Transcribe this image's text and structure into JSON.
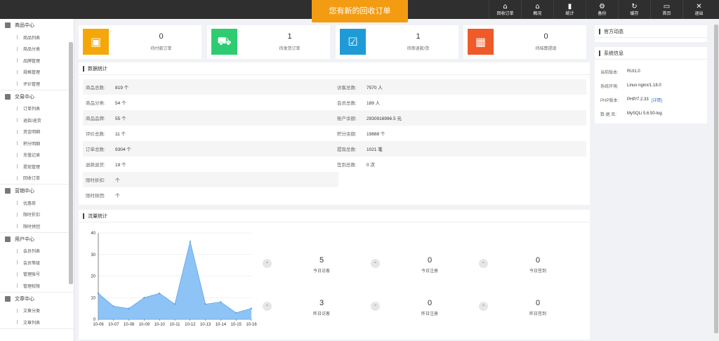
{
  "notice": "您有新的回收订单",
  "top_actions": [
    {
      "label": "回收订单",
      "icon": "home-icon",
      "glyph": "⌂"
    },
    {
      "label": "概况",
      "icon": "home-icon",
      "glyph": "⌂"
    },
    {
      "label": "统计",
      "icon": "bar-chart-icon",
      "glyph": "▮"
    },
    {
      "label": "备份",
      "icon": "gear-icon",
      "glyph": "⚙"
    },
    {
      "label": "缓存",
      "icon": "refresh-icon",
      "glyph": "↻"
    },
    {
      "label": "首页",
      "icon": "monitor-icon",
      "glyph": "▭"
    },
    {
      "label": "退出",
      "icon": "close-icon",
      "glyph": "✕"
    }
  ],
  "sidebar": {
    "groups": [
      {
        "title": "商品中心",
        "items": [
          "商品列表",
          "商品分类",
          "品牌管理",
          "规格管理",
          "评价管理"
        ]
      },
      {
        "title": "交易中心",
        "items": [
          "订单列表",
          "退款/退货",
          "资金明细",
          "积分明细",
          "充值记录",
          "提现管理",
          "回收订单"
        ]
      },
      {
        "title": "营销中心",
        "items": [
          "优惠券",
          "限时折扣",
          "限时拼团"
        ]
      },
      {
        "title": "用户中心",
        "items": [
          "会员列表",
          "会员等级",
          "管理账号",
          "管理权限"
        ]
      },
      {
        "title": "文章中心",
        "items": [
          "文章分类",
          "文章列表"
        ]
      }
    ]
  },
  "stats": [
    {
      "value": "0",
      "label": "待付款订单",
      "color": "#f5a70a",
      "icon": "wallet-icon",
      "glyph": "▣"
    },
    {
      "value": "1",
      "label": "待发货订单",
      "color": "#2ecc71",
      "icon": "truck-icon",
      "glyph": "⛟"
    },
    {
      "value": "1",
      "label": "待审退款/货",
      "color": "#1e9bd7",
      "icon": "check-box-icon",
      "glyph": "☑"
    },
    {
      "value": "0",
      "label": "待结算提现",
      "color": "#f05a28",
      "icon": "calculator-icon",
      "glyph": "▦"
    }
  ],
  "data_stats": {
    "title": "数据统计",
    "rows": [
      [
        {
          "k": "商品总数:",
          "v": "819 个"
        },
        {
          "k": "访客总数:",
          "v": "7570 人"
        }
      ],
      [
        {
          "k": "商品分类:",
          "v": "54 个"
        },
        {
          "k": "会员总数:",
          "v": "189 人"
        }
      ],
      [
        {
          "k": "商品品牌:",
          "v": "55 个"
        },
        {
          "k": "账户余额:",
          "v": "2930916996.5 元"
        }
      ],
      [
        {
          "k": "评价总数:",
          "v": "11 个"
        },
        {
          "k": "积分余额:",
          "v": "19888 个"
        }
      ],
      [
        {
          "k": "订单总数:",
          "v": "9304 个"
        },
        {
          "k": "提现总数:",
          "v": "1021 笔"
        }
      ],
      [
        {
          "k": "退款退货:",
          "v": "19 个"
        },
        {
          "k": "签到总数:",
          "v": "0 次"
        }
      ],
      [
        {
          "k": "限时折扣:",
          "v": "个"
        }
      ],
      [
        {
          "k": "限时拼团:",
          "v": "个"
        }
      ]
    ]
  },
  "official_news": {
    "title": "官方动态"
  },
  "system_info": {
    "title": "系统信息",
    "rows": [
      {
        "k": "当前版本:",
        "v": "RUI1.0",
        "link": ""
      },
      {
        "k": "系统环境:",
        "v": "Linux nginx/1.18.0",
        "link": ""
      },
      {
        "k": "PHP版本:",
        "v": "PHP/7.2.33",
        "link": "[详情]"
      },
      {
        "k": "数 据 库:",
        "v": "MySQLi 5.6.50-log",
        "link": ""
      }
    ]
  },
  "traffic": {
    "title": "流量统计",
    "boxes": [
      {
        "value": "5",
        "label": "今日访客"
      },
      {
        "value": "0",
        "label": "今日注册"
      },
      {
        "value": "0",
        "label": "今日签到"
      },
      {
        "value": "3",
        "label": "昨日访客"
      },
      {
        "value": "0",
        "label": "昨日注册"
      },
      {
        "value": "0",
        "label": "昨日签到"
      }
    ],
    "circle_glyph": "="
  },
  "chart_data": {
    "type": "area",
    "categories": [
      "10-06",
      "10-07",
      "10-08",
      "10-09",
      "10-10",
      "10-11",
      "10-12",
      "10-13",
      "10-14",
      "10-15",
      "10-16"
    ],
    "series": [
      {
        "values": [
          12,
          6,
          5,
          10,
          12,
          7,
          36,
          7,
          8,
          3,
          5
        ]
      }
    ],
    "yticks": [
      0,
      10,
      20,
      30,
      40
    ],
    "ylim": [
      0,
      40
    ],
    "grid": true,
    "color": "#7ab8f5",
    "line_color": "#5aa4ee"
  }
}
